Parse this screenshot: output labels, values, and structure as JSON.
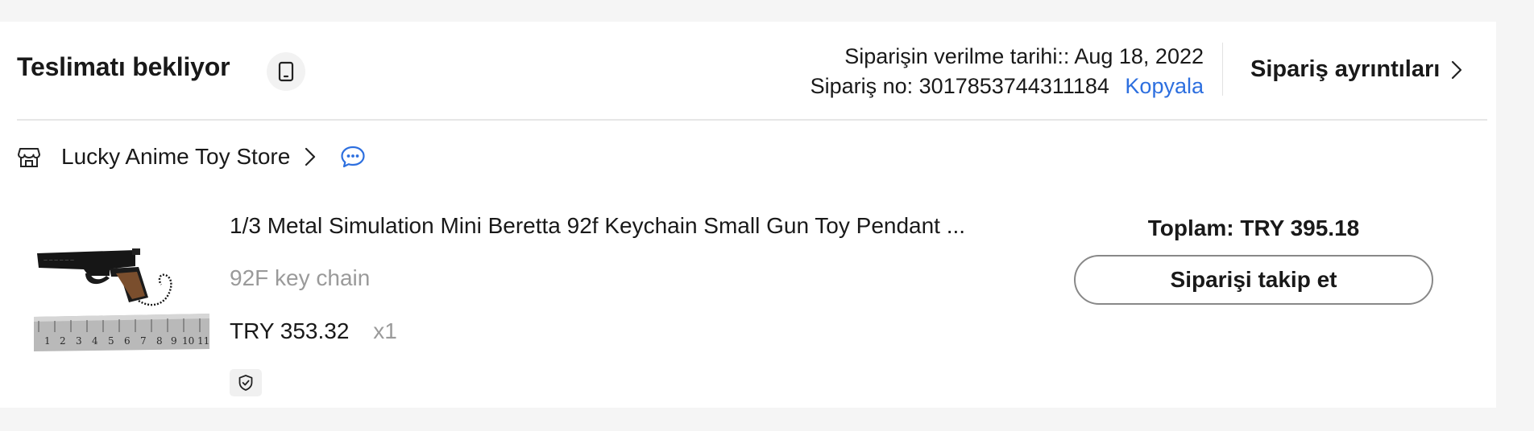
{
  "order": {
    "status": "Teslimatı bekliyor",
    "date_label": "Siparişin verilme tarihi::",
    "date_value": "Aug 18, 2022",
    "number_label": "Sipariş no:",
    "number_value": "3017853744311184",
    "copy_label": "Kopyala",
    "details_label": "Sipariş ayrıntıları"
  },
  "store": {
    "name": "Lucky Anime Toy Store"
  },
  "product": {
    "title": "1/3 Metal Simulation Mini Beretta 92f Keychain Small Gun Toy Pendant ...",
    "variant": "92F key chain",
    "price": "TRY 353.32",
    "quantity": "x1",
    "ruler_numbers": [
      "1",
      "2",
      "3",
      "4",
      "5",
      "6",
      "7",
      "8",
      "9",
      "10",
      "11"
    ]
  },
  "summary": {
    "total": "Toplam: TRY 395.18",
    "track_button": "Siparişi takip et"
  },
  "icons": {
    "status": "device-icon",
    "store": "store-icon",
    "store_arrow": "chevron-right-icon",
    "chat": "chat-icon",
    "details_arrow": "chevron-right-icon",
    "protection": "shield-check-icon"
  },
  "colors": {
    "accent_link": "#2d6fdf",
    "text_primary": "#191919",
    "text_secondary": "#9a9a9a",
    "page_background": "#f5f5f5"
  }
}
